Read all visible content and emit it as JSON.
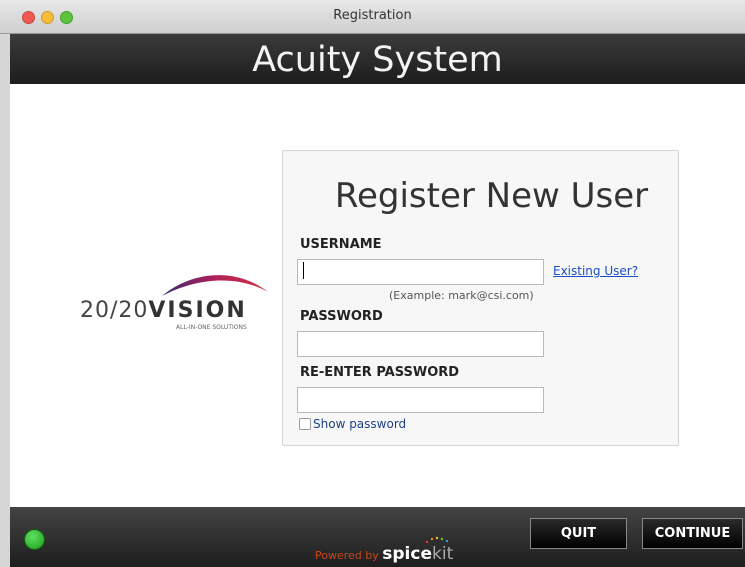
{
  "window": {
    "title": "Registration"
  },
  "header": {
    "title": "Acuity System"
  },
  "logo": {
    "text_main": "20/20",
    "text_bold": "VISION",
    "tagline": "ALL-IN-ONE SOLUTIONS"
  },
  "form": {
    "title": "Register New User",
    "username": {
      "label": "USERNAME",
      "value": "",
      "placeholder": ""
    },
    "username_hint": "(Example: mark@csi.com)",
    "existing_user_link": "Existing User?",
    "password": {
      "label": "PASSWORD",
      "value": "",
      "placeholder": ""
    },
    "reenter_password": {
      "label": "RE-ENTER PASSWORD",
      "value": "",
      "placeholder": ""
    },
    "show_password": {
      "label": "Show password",
      "checked": false
    }
  },
  "footer": {
    "status_color": "#2fb52f",
    "quit_label": "QUIT",
    "continue_label": "CONTINUE",
    "powered_by": "Powered by",
    "brand_main": "spice",
    "brand_suffix": "kit"
  }
}
